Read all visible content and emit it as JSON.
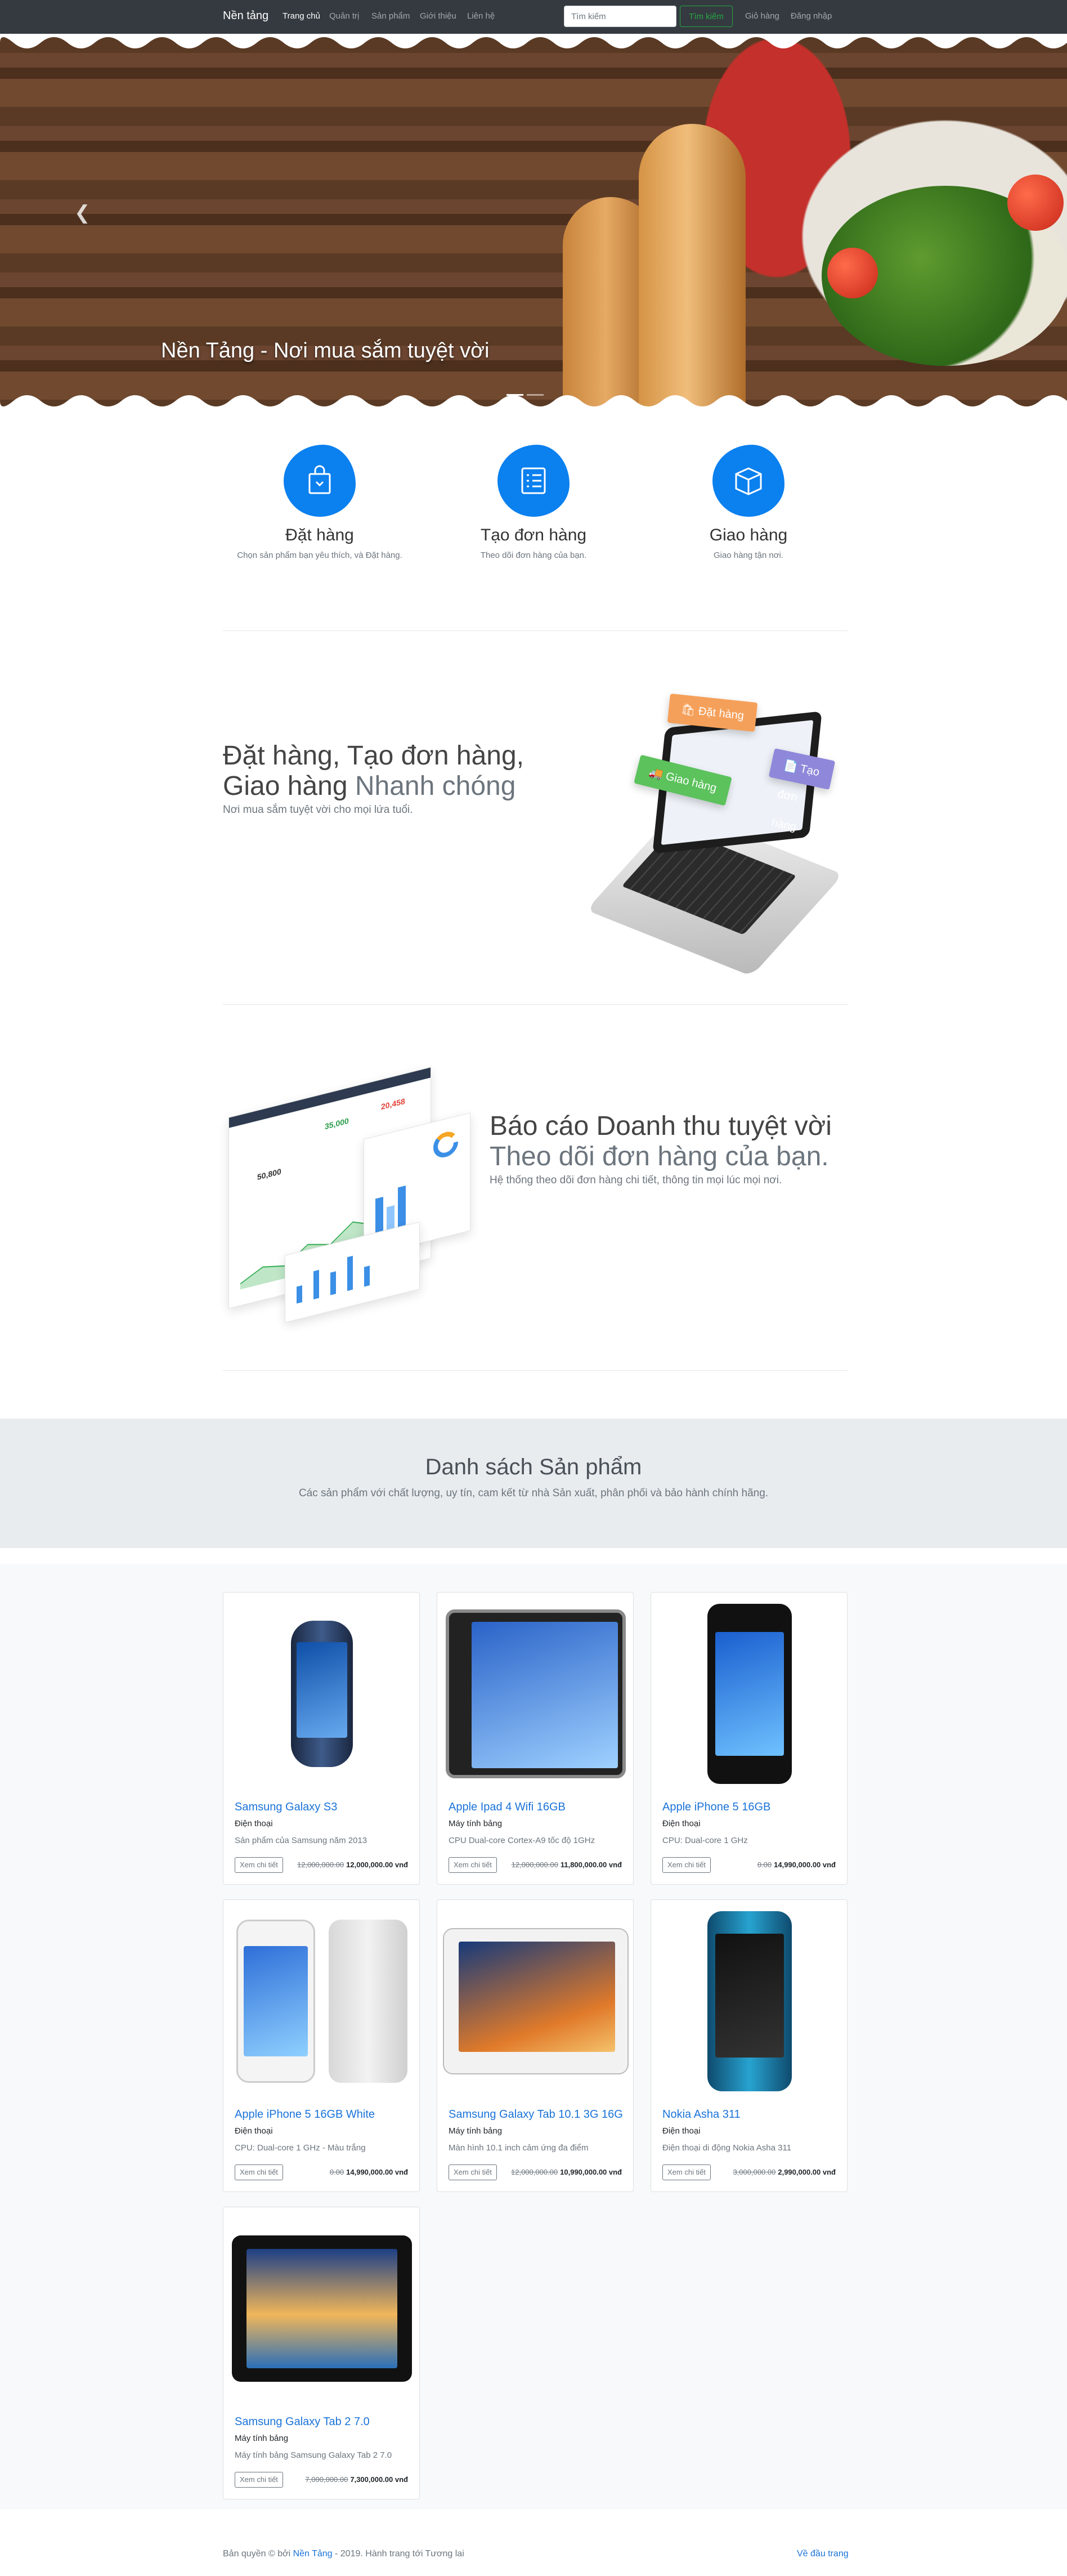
{
  "navbar": {
    "brand": "Nền tảng",
    "links": [
      "Trang chủ",
      "Quản trị",
      "Sản phẩm",
      "Giới thiệu",
      "Liên hệ"
    ],
    "search_placeholder": "Tìm kiếm",
    "search_button": "Tìm kiếm",
    "cart": "Giỏ hàng",
    "login": "Đăng nhập"
  },
  "hero": {
    "caption": "Nền Tảng - Nơi mua sắm tuyệt vời",
    "prev_icon": "chevron-left-icon"
  },
  "features": [
    {
      "icon": "shopping-bag-icon",
      "title": "Đặt hàng",
      "text": "Chọn sản phẩm bạn yêu thích, và Đặt hàng."
    },
    {
      "icon": "checklist-icon",
      "title": "Tạo đơn hàng",
      "text": "Theo dõi đơn hàng của bạn."
    },
    {
      "icon": "box-icon",
      "title": "Giao hàng",
      "text": "Giao hàng tận nơi."
    }
  ],
  "section1": {
    "title_line1": "Đặt hàng, Tạo đơn hàng,",
    "title_line2_a": "Giao hàng ",
    "title_line2_b": "Nhanh chóng",
    "subtitle": "Nơi mua sắm tuyệt vời cho mọi lứa tuổi.",
    "tags": [
      "Đặt hàng",
      "Giao hàng",
      "Tạo đơn hàng"
    ]
  },
  "section2": {
    "title_line1": "Báo cáo Doanh thu tuyệt vời",
    "title_line2": "Theo dõi đơn hàng của bạn.",
    "subtitle": "Hệ thống theo dõi đơn hàng chi tiết, thông tin mọi lúc mọi nơi.",
    "dash_numbers": [
      "35,000",
      "20,458",
      "50,800"
    ]
  },
  "products_header": {
    "title": "Danh sách Sản phẩm",
    "subtitle": "Các sản phẩm với chất lượng, uy tín, cam kết từ nhà Sản xuất, phân phối và bảo hành chính hãng."
  },
  "detail_label": "Xem chi tiết",
  "products": [
    {
      "name": "Samsung Galaxy S3",
      "category": "Điện thoại",
      "desc": "Sản phẩm của Samsung năm 2013",
      "old_price": "12,000,000.00",
      "price": "12,000,000.00 vnđ"
    },
    {
      "name": "Apple Ipad 4 Wifi 16GB",
      "category": "Máy tính bảng",
      "desc": "CPU Dual-core Cortex-A9 tốc độ 1GHz",
      "old_price": "12,000,000.00",
      "price": "11,800,000.00 vnđ"
    },
    {
      "name": "Apple iPhone 5 16GB",
      "category": "Điện thoại",
      "desc": "CPU: Dual-core 1 GHz",
      "old_price": "0.00",
      "price": "14,990,000.00 vnđ"
    },
    {
      "name": "Apple iPhone 5 16GB White",
      "category": "Điện thoại",
      "desc": "CPU: Dual-core 1 GHz - Màu trắng",
      "old_price": "0.00",
      "price": "14,990,000.00 vnđ"
    },
    {
      "name": "Samsung Galaxy Tab 10.1 3G 16G",
      "category": "Máy tính bảng",
      "desc": "Màn hình 10.1 inch cảm ứng đa điểm",
      "old_price": "12,000,000.00",
      "price": "10,990,000.00 vnđ"
    },
    {
      "name": "Nokia Asha 311",
      "category": "Điện thoại",
      "desc": "Điện thoại di động Nokia Asha 311",
      "old_price": "3,000,000.00",
      "price": "2,990,000.00 vnđ"
    },
    {
      "name": "Samsung Galaxy Tab 2 7.0",
      "category": "Máy tính bảng",
      "desc": "Máy tính bảng Samsung Galaxy Tab 2 7.0",
      "old_price": "7,000,000.00",
      "price": "7,300,000.00 vnđ"
    }
  ],
  "footer": {
    "prefix": "Bản quyền © bởi ",
    "brand": "Nền Tảng",
    "suffix": " - 2019. Hành trang tới Tương lai",
    "back_to_top": "Về đầu trang"
  }
}
